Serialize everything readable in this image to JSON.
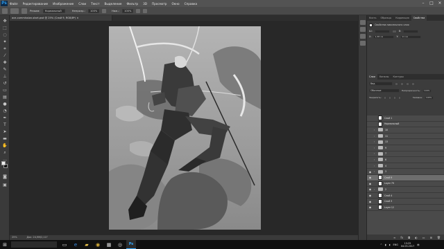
{
  "app": {
    "logo": "Ps",
    "menu": [
      "Файл",
      "Редактирование",
      "Изображение",
      "Слои",
      "Текст",
      "Выделение",
      "Фильтр",
      "3D",
      "Просмотр",
      "Окно",
      "Справка"
    ]
  },
  "options_bar": {
    "mode_label": "Режим:",
    "mode_value": "Нормальный",
    "opacity_label": "Непрозр.:",
    "opacity_value": "100%",
    "flow_label": "Наж.:",
    "flow_value": "100%"
  },
  "document": {
    "tab_title": "ace-commission-start.psd @ 25% (Слой 9, RGB/8*) ×",
    "zoom": "25%",
    "doc_size": "Док: 24,9М/2,11Г"
  },
  "properties_panel": {
    "tabs": [
      "Кисть",
      "Образцы",
      "Коррекция",
      "Свойства"
    ],
    "title": "Свойства пиксельного слоя",
    "w_label": "Ш:",
    "w_value": "",
    "h_label": "В:",
    "h_value": "",
    "x_label": "X:",
    "x_value": "1,38 см",
    "y_label": "Y:",
    "y_value": "11 см"
  },
  "layers_panel": {
    "tabs": [
      "Слои",
      "Каналы",
      "Контуры"
    ],
    "filter_label": "Вид",
    "blend_mode": "Обычные",
    "opacity_label": "Непрозрачность:",
    "opacity_value": "100%",
    "lock_label": "Закрепить:",
    "fill_label": "Заливка:",
    "fill_value": "100%",
    "layers": [
      {
        "name": "Слой 1",
        "kind": "layer",
        "visible": false
      },
      {
        "name": "Нормальный",
        "kind": "layer",
        "visible": false
      },
      {
        "name": "10",
        "kind": "folder",
        "visible": false
      },
      {
        "name": "11",
        "kind": "folder",
        "visible": false
      },
      {
        "name": "13",
        "kind": "folder",
        "visible": false
      },
      {
        "name": "9",
        "kind": "folder",
        "visible": false
      },
      {
        "name": "7",
        "kind": "folder",
        "visible": false
      },
      {
        "name": "6",
        "kind": "folder",
        "visible": false
      },
      {
        "name": "4",
        "kind": "folder",
        "visible": false
      },
      {
        "name": "3",
        "kind": "folder",
        "visible": true
      },
      {
        "name": "Слой 9",
        "kind": "layer",
        "visible": true,
        "selected": true
      },
      {
        "name": "Layer 79",
        "kind": "layer",
        "visible": true
      },
      {
        "name": "2",
        "kind": "folder",
        "visible": true
      },
      {
        "name": "Слой 4",
        "kind": "layer",
        "visible": true
      },
      {
        "name": "Слой 3",
        "kind": "layer",
        "visible": true
      },
      {
        "name": "Layer 12",
        "kind": "layer",
        "visible": true
      }
    ]
  },
  "taskbar": {
    "search_placeholder": "",
    "tray_lang": "ENG",
    "time": "13:25",
    "date": "04.03.2017"
  }
}
